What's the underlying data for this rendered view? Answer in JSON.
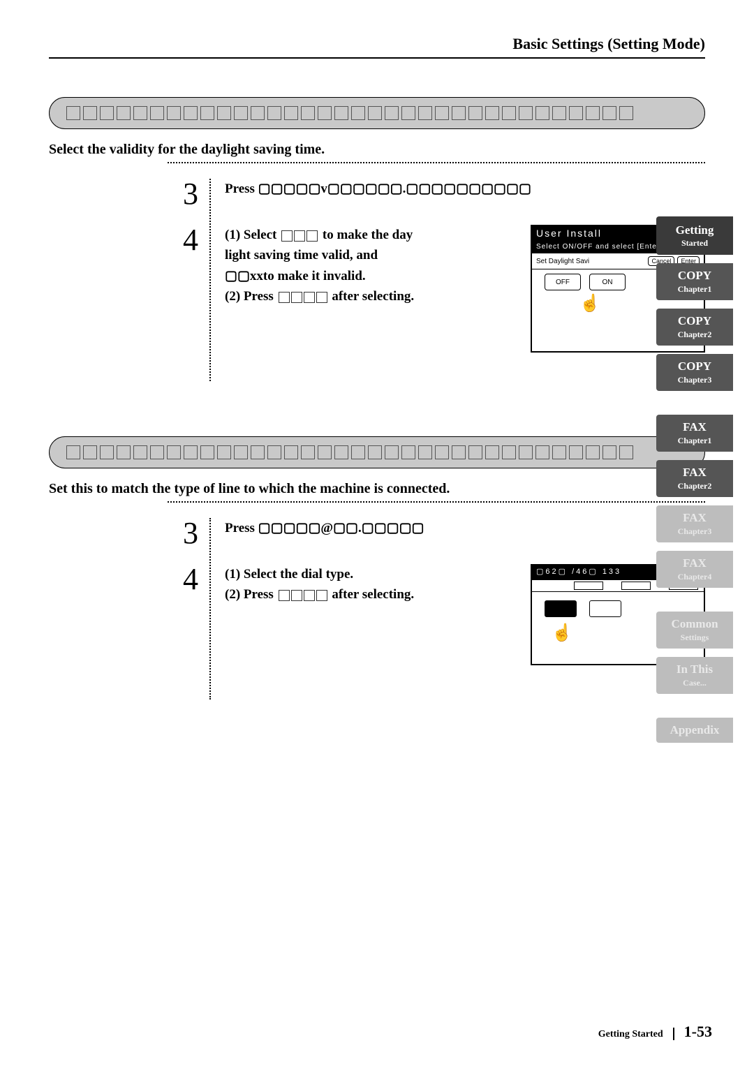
{
  "header": {
    "title": "Basic Settings (Setting Mode)"
  },
  "section1": {
    "desc": "Select the validity for the daylight saving time.",
    "step3": {
      "num": "3",
      "body": "Press ▢▢▢▢▢v▢▢▢▢▢▢.▢▢▢▢▢▢▢▢▢▢"
    },
    "step4": {
      "num": "4",
      "l1a": "(1) Select",
      "l1b": "to make the day",
      "l2": "light saving time valid, and",
      "l3a": "▢▢xx",
      "l3b": "to make it invalid.",
      "l4a": "(2) Press",
      "l4b": "after selecting."
    },
    "screen": {
      "title": "User Install",
      "sub": "Select ON/OFF and select [Ente",
      "row": "Set Daylight Savi",
      "cancel": "Cancel",
      "enter": "Enter",
      "off": "OFF",
      "on": "ON"
    }
  },
  "section2": {
    "desc": "Set this to match the type of line to which the machine is connected.",
    "step3": {
      "num": "3",
      "body": "Press ▢▢▢▢▢@▢▢.▢▢▢▢▢"
    },
    "step4": {
      "num": "4",
      "l1": "(1) Select the dial type.",
      "l2a": "(2) Press",
      "l2b": "after selecting."
    },
    "screen": {
      "title": "▢62▢ /46▢ 133"
    }
  },
  "tabs": [
    {
      "label": "Getting",
      "sub": "Started",
      "cls": "dark get"
    },
    {
      "label": "COPY",
      "sub": "Chapter1",
      "cls": "mid"
    },
    {
      "label": "COPY",
      "sub": "Chapter2",
      "cls": "mid"
    },
    {
      "label": "COPY",
      "sub": "Chapter3",
      "cls": "mid"
    },
    {
      "label": "FAX",
      "sub": "Chapter1",
      "cls": "mid",
      "gap": true
    },
    {
      "label": "FAX",
      "sub": "Chapter2",
      "cls": "mid"
    },
    {
      "label": "FAX",
      "sub": "Chapter3",
      "cls": "light"
    },
    {
      "label": "FAX",
      "sub": "Chapter4",
      "cls": "light"
    },
    {
      "label": "Common",
      "sub": "Settings",
      "cls": "light",
      "gap": true
    },
    {
      "label": "In This",
      "sub": "Case...",
      "cls": "light"
    },
    {
      "label": "Appendix",
      "sub": "",
      "cls": "light",
      "gap": true
    }
  ],
  "footer": {
    "lbl": "Getting Started",
    "pg": "1-53"
  }
}
